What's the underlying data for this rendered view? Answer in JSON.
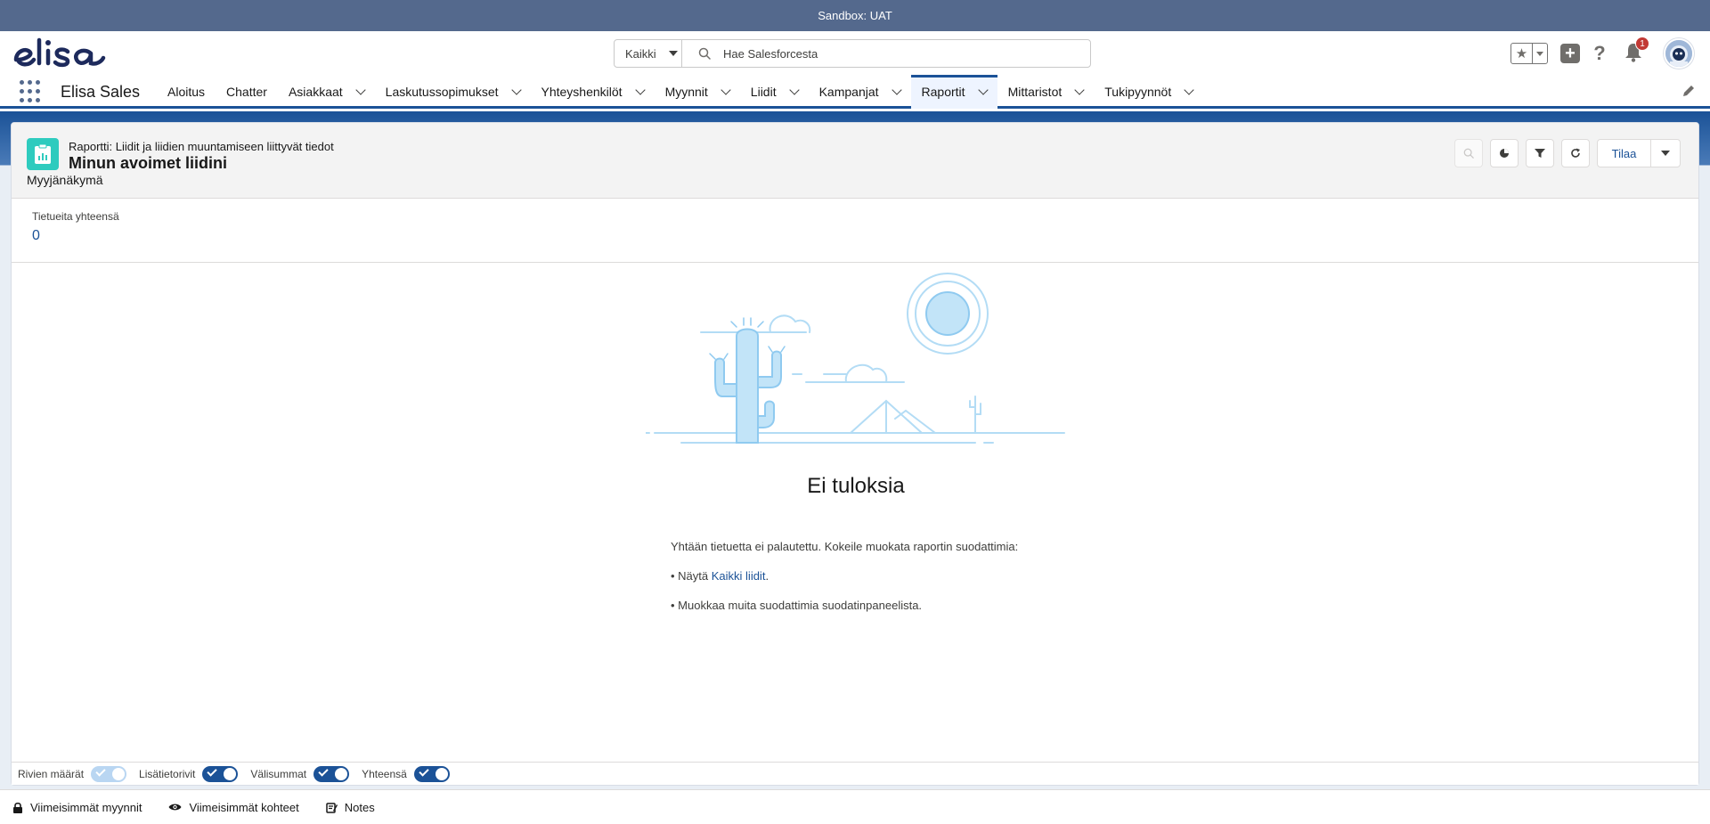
{
  "sandbox": {
    "label": "Sandbox: UAT"
  },
  "header": {
    "search_scope": "Kaikki",
    "search_placeholder": "Hae Salesforcesta",
    "notification_count": "1"
  },
  "nav": {
    "app_name": "Elisa Sales",
    "items": [
      {
        "label": "Aloitus",
        "has_menu": false,
        "active": false
      },
      {
        "label": "Chatter",
        "has_menu": false,
        "active": false
      },
      {
        "label": "Asiakkaat",
        "has_menu": true,
        "active": false
      },
      {
        "label": "Laskutussopimukset",
        "has_menu": true,
        "active": false
      },
      {
        "label": "Yhteyshenkilöt",
        "has_menu": true,
        "active": false
      },
      {
        "label": "Myynnit",
        "has_menu": true,
        "active": false
      },
      {
        "label": "Liidit",
        "has_menu": true,
        "active": false
      },
      {
        "label": "Kampanjat",
        "has_menu": true,
        "active": false
      },
      {
        "label": "Raportit",
        "has_menu": true,
        "active": true
      },
      {
        "label": "Mittaristot",
        "has_menu": true,
        "active": false
      },
      {
        "label": "Tukipyynnöt",
        "has_menu": true,
        "active": false
      }
    ]
  },
  "report": {
    "type_label": "Raportti: Liidit ja liidien muuntamiseen liittyvät tiedot",
    "title": "Minun avoimet liidini",
    "subtitle": "Myyjänäkymä",
    "subscribe_label": "Tilaa",
    "summary_label": "Tietueita yhteensä",
    "summary_value": "0"
  },
  "empty_state": {
    "title": "Ei tuloksia",
    "description": "Yhtään tietuetta ei palautettu. Kokeile muokata raportin suodattimia:",
    "bullet1_prefix": "• Näytä ",
    "bullet1_link": "Kaikki liidit",
    "bullet1_suffix": ".",
    "bullet2": "• Muokkaa muita suodattimia suodatinpaneelista."
  },
  "footer_toggles": [
    {
      "label": "Rivien määrät",
      "on": true,
      "disabled": true
    },
    {
      "label": "Lisätietorivit",
      "on": true,
      "disabled": false
    },
    {
      "label": "Välisummat",
      "on": true,
      "disabled": false
    },
    {
      "label": "Yhteensä",
      "on": true,
      "disabled": false
    }
  ],
  "utility_bar": [
    {
      "label": "Viimeisimmät myynnit",
      "icon": "lock-icon"
    },
    {
      "label": "Viimeisimmät kohteet",
      "icon": "eye-icon"
    },
    {
      "label": "Notes",
      "icon": "note-icon"
    }
  ],
  "colors": {
    "brand": "#1b5297",
    "sandbox_bar": "#54698d",
    "report_icon": "#2ecbbe"
  }
}
